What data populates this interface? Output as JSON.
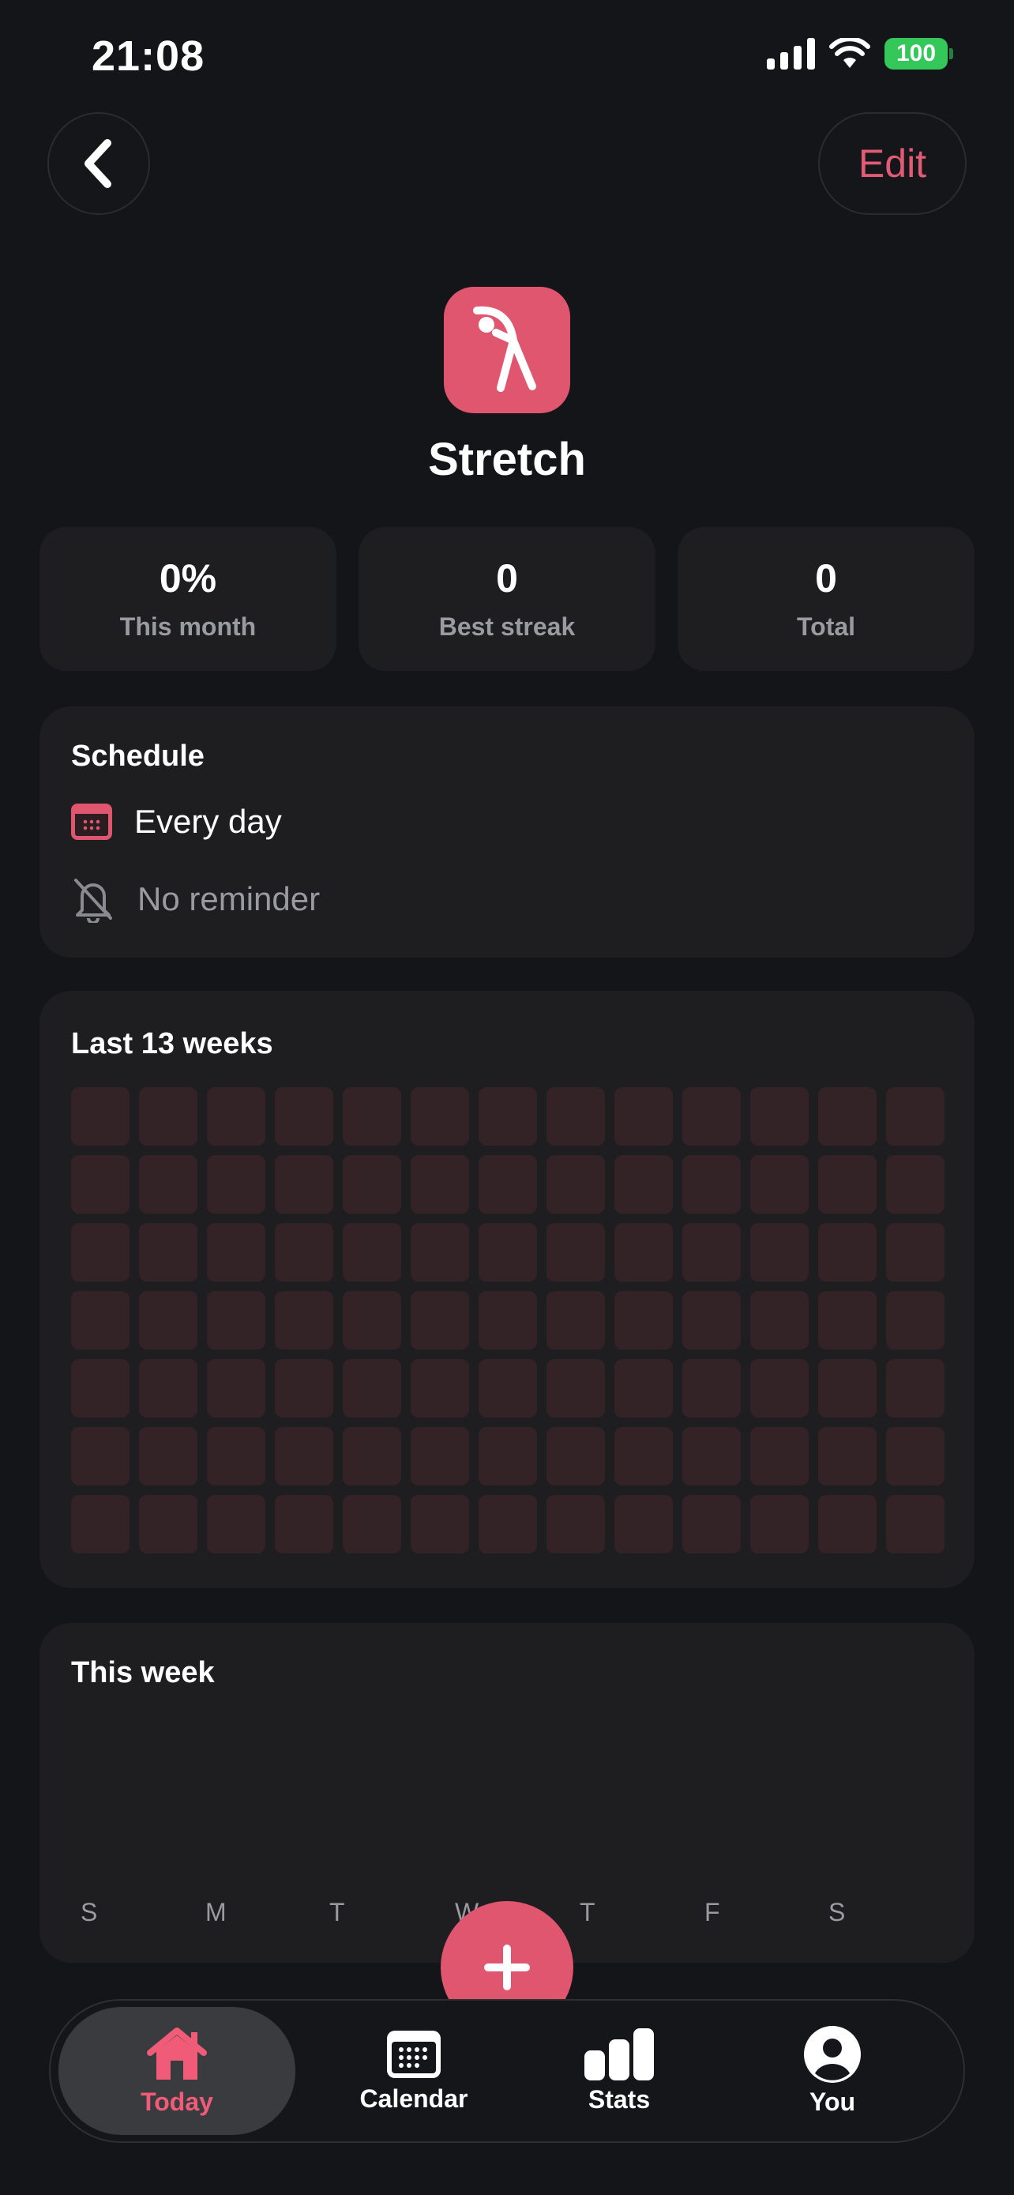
{
  "status_bar": {
    "time": "21:08",
    "battery": "100"
  },
  "nav": {
    "edit_label": "Edit"
  },
  "habit": {
    "name": "Stretch",
    "accent_color": "#e0566f",
    "icon": "stretch-figure-icon"
  },
  "stats": [
    {
      "value": "0%",
      "label": "This month"
    },
    {
      "value": "0",
      "label": "Best streak"
    },
    {
      "value": "0",
      "label": "Total"
    }
  ],
  "schedule": {
    "title": "Schedule",
    "frequency": "Every day",
    "reminder": "No reminder"
  },
  "history": {
    "title": "Last 13 weeks",
    "weeks": 13,
    "days_per_week": 7,
    "completed_cells": 0
  },
  "this_week": {
    "title": "This week",
    "days": [
      "S",
      "M",
      "T",
      "W",
      "T",
      "F",
      "S"
    ]
  },
  "tabbar": {
    "tabs": [
      {
        "label": "Today",
        "icon": "home-icon",
        "active": true
      },
      {
        "label": "Calendar",
        "icon": "calendar-icon",
        "active": false
      },
      {
        "label": "Stats",
        "icon": "bar-chart-icon",
        "active": false
      },
      {
        "label": "You",
        "icon": "person-icon",
        "active": false
      }
    ]
  }
}
